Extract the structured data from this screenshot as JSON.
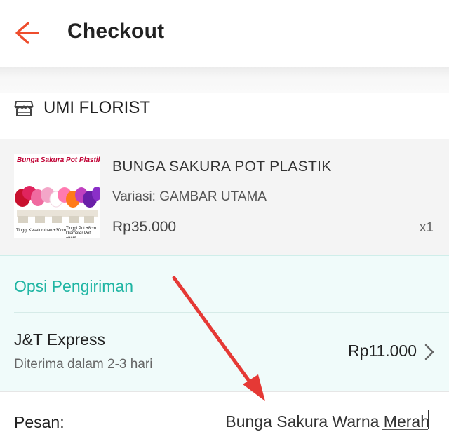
{
  "header": {
    "title": "Checkout",
    "back_icon": "arrow-left-icon",
    "accent_color": "#ee4d2d"
  },
  "shop": {
    "name": "UMI FLORIST",
    "icon": "store-icon"
  },
  "product": {
    "name": "BUNGA SAKURA POT PLASTIK",
    "variation": "Variasi: GAMBAR UTAMA",
    "price": "Rp35.000",
    "quantity": "x1",
    "image": {
      "title": "Bunga Sakura Pot Plastik",
      "caption_left": "Tinggi Keseluruhan ±30cm",
      "caption_right": "Tinggi Pot ±8cm Diameter Pot ±6cm"
    }
  },
  "shipping": {
    "section_label": "Opsi Pengiriman",
    "carrier": "J&T Express",
    "eta": "Diterima dalam 2-3 hari",
    "fee": "Rp11.000",
    "accent_color": "#1fb5a3"
  },
  "message": {
    "label": "Pesan:",
    "value": "Bunga Sakura Warna Merah"
  },
  "annotation": {
    "arrow_color": "#e53935"
  }
}
